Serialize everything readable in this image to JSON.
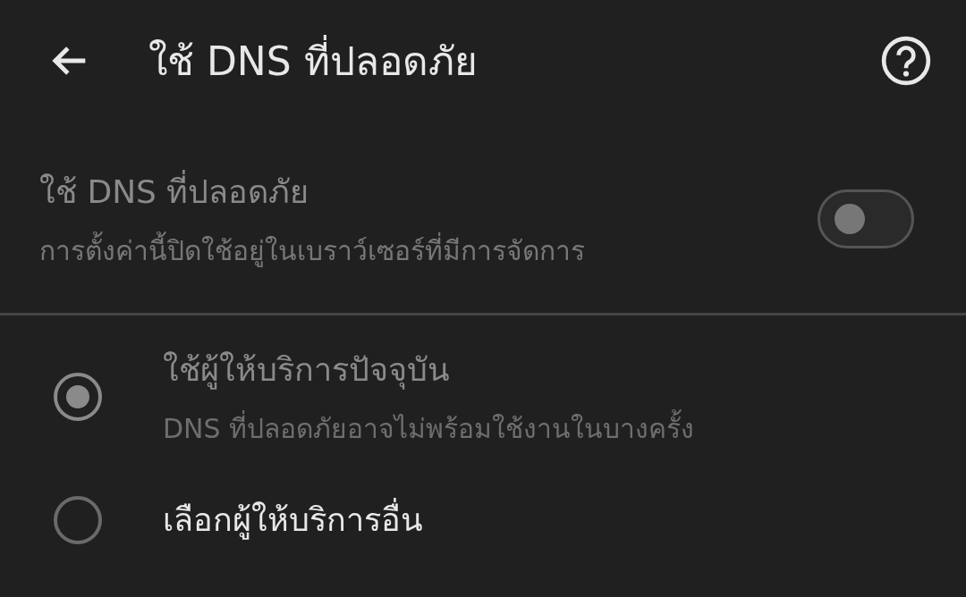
{
  "header": {
    "title": "ใช้ DNS ที่ปลอดภัย"
  },
  "secure_dns": {
    "title": "ใช้ DNS ที่ปลอดภัย",
    "subtitle": "การตั้งค่านี้ปิดใช้อยู่ในเบราว์เซอร์ที่มีการจัดการ",
    "on": false,
    "disabled": true
  },
  "options": [
    {
      "title": "ใช้ผู้ให้บริการปัจจุบัน",
      "subtitle": "DNS ที่ปลอดภัยอาจไม่พร้อมใช้งานในบางครั้ง",
      "selected": true,
      "disabled": true
    },
    {
      "title": "เลือกผู้ให้บริการอื่น",
      "selected": false,
      "disabled": false
    }
  ]
}
